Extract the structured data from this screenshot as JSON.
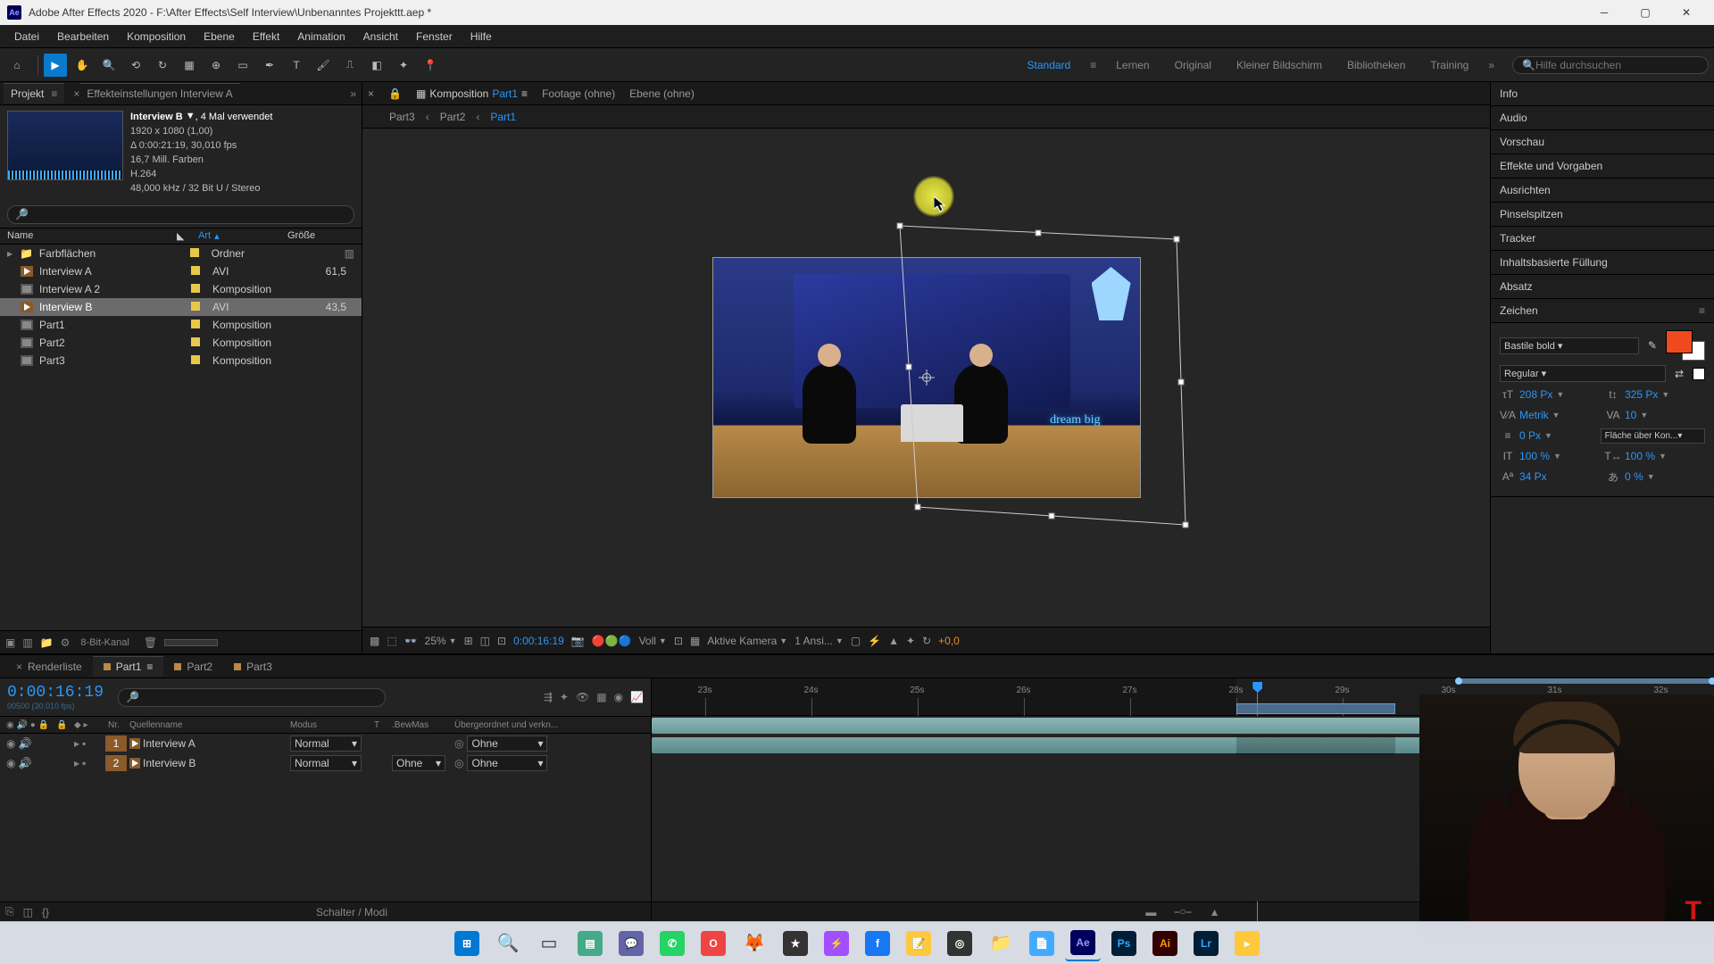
{
  "title": "Adobe After Effects 2020 - F:\\After Effects\\Self Interview\\Unbenanntes Projekttt.aep *",
  "menu": [
    "Datei",
    "Bearbeiten",
    "Komposition",
    "Ebene",
    "Effekt",
    "Animation",
    "Ansicht",
    "Fenster",
    "Hilfe"
  ],
  "workspaces": [
    "Standard",
    "Lernen",
    "Original",
    "Kleiner Bildschirm",
    "Bibliotheken",
    "Training"
  ],
  "workspace_active": "Standard",
  "search_placeholder": "Hilfe durchsuchen",
  "project_panel": {
    "tab": "Projekt",
    "secondary_tab": "Effekteinstellungen Interview A",
    "item": {
      "name": "Interview B",
      "used": ", 4 Mal verwendet",
      "dims": "1920 x 1080 (1,00)",
      "dur": "Δ 0:00:21:19, 30,010 fps",
      "color": "16,7 Mill. Farben",
      "codec": "H.264",
      "audio": "48,000 kHz / 32 Bit U / Stereo"
    },
    "columns": {
      "name": "Name",
      "art": "Art",
      "size": "Größe"
    },
    "rows": [
      {
        "twisty": "▸",
        "icon": "folder",
        "name": "Farbflächen",
        "art": "Ordner",
        "size": "",
        "extra": "▥"
      },
      {
        "twisty": "",
        "icon": "video",
        "name": "Interview A",
        "art": "AVI",
        "size": "61,5"
      },
      {
        "twisty": "",
        "icon": "comp",
        "name": "Interview A 2",
        "art": "Komposition",
        "size": ""
      },
      {
        "twisty": "",
        "icon": "video",
        "name": "Interview B",
        "art": "AVI",
        "size": "43,5",
        "selected": true
      },
      {
        "twisty": "",
        "icon": "comp",
        "name": "Part1",
        "art": "Komposition",
        "size": ""
      },
      {
        "twisty": "",
        "icon": "comp",
        "name": "Part2",
        "art": "Komposition",
        "size": ""
      },
      {
        "twisty": "",
        "icon": "comp",
        "name": "Part3",
        "art": "Komposition",
        "size": ""
      }
    ],
    "footer_depth": "8-Bit-Kanal"
  },
  "comp_panel": {
    "tab_label": "Komposition",
    "tab_link": "Part1",
    "footage_tab": "Footage (ohne)",
    "layer_tab": "Ebene (ohne)",
    "breadcrumb": [
      "Part3",
      "Part2",
      "Part1"
    ],
    "controls": {
      "zoom": "25%",
      "tc": "0:00:16:19",
      "res": "Voll",
      "camera": "Aktive Kamera",
      "views": "1 Ansi...",
      "exposure": "+0,0"
    }
  },
  "right_panels": [
    "Info",
    "Audio",
    "Vorschau",
    "Effekte und Vorgaben",
    "Ausrichten",
    "Pinselspitzen",
    "Tracker",
    "Inhaltsbasierte Füllung",
    "Absatz"
  ],
  "char_panel": {
    "title": "Zeichen",
    "font": "Bastile bold",
    "style": "Regular",
    "fill_color": "#ef4a1f",
    "size": "208 Px",
    "leading": "325 Px",
    "kerning": "Metrik",
    "tracking": "10",
    "stroke": "0 Px",
    "stroke_opt": "Fläche über Kon...",
    "vscale": "100 %",
    "hscale": "100 %",
    "baseline": "34 Px",
    "tsume": "0 %"
  },
  "timeline": {
    "tabs": [
      {
        "name": "Renderliste",
        "closable": true
      },
      {
        "name": "Part1",
        "active": true
      },
      {
        "name": "Part2"
      },
      {
        "name": "Part3"
      }
    ],
    "tc": "0:00:16:19",
    "sub": "00500 (30,010 fps)",
    "columns": {
      "num": "Nr.",
      "src": "Quellenname",
      "mode": "Modus",
      "t": "T",
      "trk": ".BewMas",
      "parent": "Übergeordnet und verkn..."
    },
    "layers": [
      {
        "num": "1",
        "name": "Interview A",
        "mode": "Normal",
        "trk": "",
        "parent": "Ohne"
      },
      {
        "num": "2",
        "name": "Interview B",
        "mode": "Normal",
        "trk": "Ohne",
        "parent": "Ohne"
      }
    ],
    "ruler_ticks": [
      "23s",
      "24s",
      "25s",
      "26s",
      "27s",
      "28s",
      "29s",
      "30s",
      "31s",
      "32s"
    ],
    "footer": "Schalter / Modi"
  },
  "taskbar": [
    {
      "name": "start",
      "glyph": "⊞",
      "color": "#0078d4"
    },
    {
      "name": "search",
      "glyph": "🔍"
    },
    {
      "name": "taskview",
      "glyph": "▭"
    },
    {
      "name": "widgets",
      "glyph": "▤",
      "color": "#4a8"
    },
    {
      "name": "teams",
      "glyph": "💬",
      "color": "#6264a7"
    },
    {
      "name": "whatsapp",
      "glyph": "✆",
      "color": "#25d366"
    },
    {
      "name": "opera",
      "glyph": "O",
      "color": "#e44"
    },
    {
      "name": "firefox",
      "glyph": "🦊"
    },
    {
      "name": "app1",
      "glyph": "★",
      "color": "#333"
    },
    {
      "name": "messenger",
      "glyph": "⚡",
      "color": "#a050ff"
    },
    {
      "name": "facebook",
      "glyph": "f",
      "color": "#1877f2"
    },
    {
      "name": "notes",
      "glyph": "📝",
      "color": "#ffc83d"
    },
    {
      "name": "obs",
      "glyph": "◎",
      "color": "#333"
    },
    {
      "name": "explorer",
      "glyph": "📁"
    },
    {
      "name": "notepad",
      "glyph": "📄",
      "color": "#4af"
    },
    {
      "name": "ae",
      "glyph": "Ae",
      "color": "#00005b",
      "text": "#9999ff",
      "active": true
    },
    {
      "name": "ps",
      "glyph": "Ps",
      "color": "#001e36",
      "text": "#31a8ff"
    },
    {
      "name": "ai",
      "glyph": "Ai",
      "color": "#330000",
      "text": "#ff9a00"
    },
    {
      "name": "lr",
      "glyph": "Lr",
      "color": "#001e36",
      "text": "#31a8ff"
    },
    {
      "name": "more",
      "glyph": "▸",
      "color": "#ffc83d"
    }
  ]
}
